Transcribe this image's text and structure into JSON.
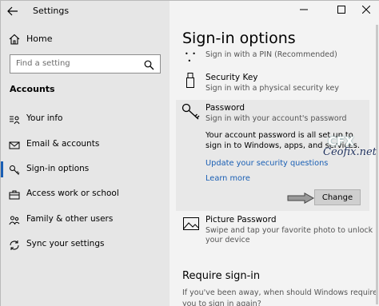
{
  "app": {
    "title": "Settings"
  },
  "sidebar": {
    "home_label": "Home",
    "search_placeholder": "Find a setting",
    "section": "Accounts",
    "items": [
      {
        "label": "Your info",
        "icon": "person-card-icon"
      },
      {
        "label": "Email & accounts",
        "icon": "envelope-icon"
      },
      {
        "label": "Sign-in options",
        "icon": "key-icon",
        "active": true
      },
      {
        "label": "Access work or school",
        "icon": "briefcase-icon"
      },
      {
        "label": "Family & other users",
        "icon": "people-icon"
      },
      {
        "label": "Sync your settings",
        "icon": "sync-icon"
      }
    ]
  },
  "window_controls": {
    "minimize": "minimize-icon",
    "maximize": "maximize-icon",
    "close": "close-icon"
  },
  "main": {
    "title": "Sign-in options",
    "pin_subtitle": "Sign in with a PIN (Recommended)",
    "security_key": {
      "title": "Security Key",
      "subtitle": "Sign in with a physical security key"
    },
    "password": {
      "title": "Password",
      "subtitle": "Sign in with your account's password",
      "description": "Your account password is all set up to sign in to Windows, apps, and services.",
      "link_security_questions": "Update your security questions",
      "link_learn_more": "Learn more",
      "change_button": "Change"
    },
    "picture_password": {
      "title": "Picture Password",
      "subtitle_line1": "Swipe and tap your favorite photo to unlock",
      "subtitle_line2": "your device"
    },
    "require_signin": {
      "title": "Require sign-in",
      "subtitle_line1": "If you've been away, when should Windows require",
      "subtitle_line2": "you to sign in again?"
    }
  },
  "watermark": {
    "logo": "CFX",
    "text": "Ceofix.net"
  },
  "colors": {
    "accent": "#1a5fb4",
    "sidebar_bg": "#e6e6e6",
    "main_bg": "#f3f3f3"
  }
}
